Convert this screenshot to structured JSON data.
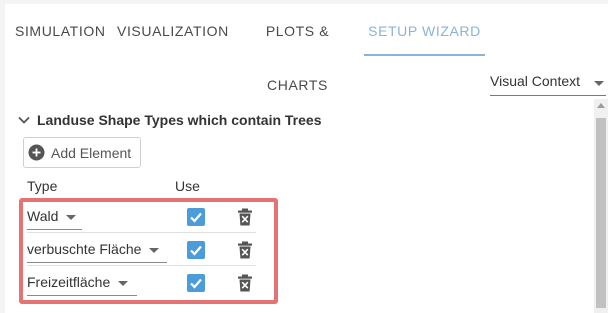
{
  "tabs": [
    {
      "label": "SIMULATION",
      "active": false
    },
    {
      "label": "VISUALIZATION",
      "active": false
    },
    {
      "label": "PLOTS & CHARTS",
      "active": false
    },
    {
      "label": "SETUP WIZARD",
      "active": true
    }
  ],
  "context_select": {
    "value": "Visual Context"
  },
  "section": {
    "title": "Landuse Shape Types which contain Trees",
    "add_button_label": "Add Element",
    "columns": {
      "type": "Type",
      "use": "Use"
    },
    "rows": [
      {
        "type": "Wald",
        "use": true
      },
      {
        "type": "verbuschte Fläche",
        "use": true
      },
      {
        "type": "Freizeitfläche",
        "use": true
      }
    ]
  },
  "colors": {
    "accent": "#8ab3dc",
    "checkbox": "#4b9cd9",
    "highlight": "#e57373"
  }
}
